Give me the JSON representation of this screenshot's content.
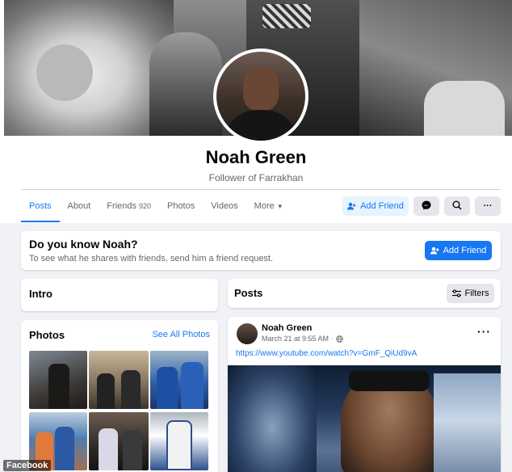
{
  "profile": {
    "name": "Noah Green",
    "bio": "Follower of Farrakhan"
  },
  "tabs": [
    {
      "label": "Posts",
      "active": true
    },
    {
      "label": "About"
    },
    {
      "label": "Friends",
      "count": "920"
    },
    {
      "label": "Photos"
    },
    {
      "label": "Videos"
    },
    {
      "label": "More",
      "dropdown": true
    }
  ],
  "actions": {
    "add_friend": "Add Friend",
    "messenger_icon": "messenger-icon",
    "search_icon": "search-icon",
    "more_label": "···"
  },
  "know_card": {
    "title": "Do you know Noah?",
    "subtitle": "To see what he shares with friends, send him a friend request.",
    "button": "Add Friend"
  },
  "intro": {
    "title": "Intro"
  },
  "photos": {
    "title": "Photos",
    "see_all": "See All Photos"
  },
  "posts_section": {
    "title": "Posts",
    "filters": "Filters"
  },
  "post": {
    "author": "Noah Green",
    "time": "March 21 at 9:55 AM ·",
    "link": "https://www.youtube.com/watch?v=GmF_QiUd9vA",
    "more": "···"
  },
  "watermark": "Facebook",
  "colors": {
    "accent": "#1877f2",
    "accent_light": "#e7f3ff",
    "page_bg": "#f0f2f5",
    "secondary_text": "#65676b"
  }
}
